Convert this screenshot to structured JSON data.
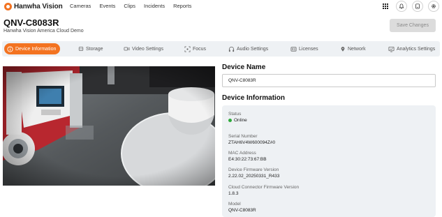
{
  "brand": {
    "name": "Hanwha Vision",
    "accent": "#f37321"
  },
  "nav": {
    "items": [
      "Cameras",
      "Events",
      "Clips",
      "Incidents",
      "Reports"
    ]
  },
  "header_icons": [
    "apps-grid-icon",
    "bell-icon",
    "book-icon",
    "gear-icon"
  ],
  "page": {
    "title": "QNV-C8083R",
    "subtitle": "Hanwha Vision America Cloud Demo",
    "save_label": "Save Changes"
  },
  "tabs": [
    {
      "label": "Device Information",
      "icon": "info-icon",
      "active": true
    },
    {
      "label": "Storage",
      "icon": "storage-icon",
      "active": false
    },
    {
      "label": "Video Settings",
      "icon": "video-icon",
      "active": false
    },
    {
      "label": "Focus",
      "icon": "focus-icon",
      "active": false
    },
    {
      "label": "Audio Settings",
      "icon": "headphones-icon",
      "active": false
    },
    {
      "label": "Licenses",
      "icon": "license-icon",
      "active": false
    },
    {
      "label": "Network",
      "icon": "location-icon",
      "active": false
    },
    {
      "label": "Analytics Settings",
      "icon": "analytics-icon",
      "active": false
    }
  ],
  "device_name": {
    "heading": "Device Name",
    "value": "QNV-C8083R"
  },
  "device_info": {
    "heading": "Device Information",
    "status": {
      "label": "Status",
      "value": "Online",
      "color": "#2eaa3b"
    },
    "serial": {
      "label": "Serial Number",
      "value": "ZTAH6V4W600094Z#0"
    },
    "mac": {
      "label": "MAC Address",
      "value": "E4:30:22:73:67:BB"
    },
    "firmware": {
      "label": "Device Firmware Version",
      "value": "2.22.02_20250331_R433"
    },
    "connector": {
      "label": "Cloud Connector Firmware Version",
      "value": "1.8.3"
    },
    "model": {
      "label": "Model",
      "value": "QNV-C8083R"
    }
  }
}
